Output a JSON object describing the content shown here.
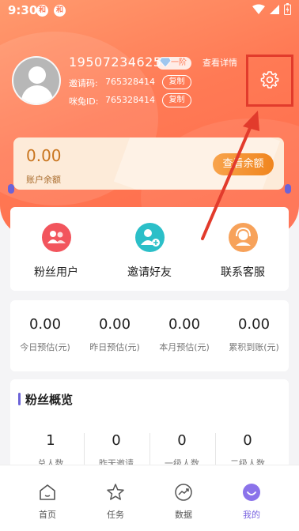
{
  "status_bar": {
    "time": "9:30",
    "badges": [
      "和",
      "和"
    ]
  },
  "profile": {
    "phone": "19507234625",
    "level": "一阶",
    "view_detail": "查看详情",
    "invite_code_label": "邀请码:",
    "invite_code": "765328414",
    "mitu_id_label": "咪兔ID:",
    "mitu_id": "765328414",
    "copy_label": "复制"
  },
  "balance": {
    "amount": "0.00",
    "label": "账户余额",
    "button": "查看余额"
  },
  "actions": [
    {
      "label": "粉丝用户",
      "icon": "fans-icon",
      "color": "#f2555d"
    },
    {
      "label": "邀请好友",
      "icon": "invite-friend-icon",
      "color": "#2bbfc8"
    },
    {
      "label": "联系客服",
      "icon": "customer-service-icon",
      "color": "#f7a25a"
    }
  ],
  "stats": [
    {
      "value": "0.00",
      "label": "今日预估(元)"
    },
    {
      "value": "0.00",
      "label": "昨日预估(元)"
    },
    {
      "value": "0.00",
      "label": "本月预估(元)"
    },
    {
      "value": "0.00",
      "label": "累积到账(元)"
    }
  ],
  "fans_overview": {
    "title": "粉丝概览",
    "items": [
      {
        "value": "1",
        "label": "总人数"
      },
      {
        "value": "0",
        "label": "昨天邀请"
      },
      {
        "value": "0",
        "label": "一级人数"
      },
      {
        "value": "0",
        "label": "二级人数"
      }
    ]
  },
  "tabs": [
    {
      "label": "首页",
      "icon": "home-icon",
      "active": false
    },
    {
      "label": "任务",
      "icon": "star-icon",
      "active": false
    },
    {
      "label": "数据",
      "icon": "chart-icon",
      "active": false
    },
    {
      "label": "我的",
      "icon": "profile-icon",
      "active": true
    }
  ],
  "colors": {
    "header_gradient_start": "#ff9a6e",
    "header_gradient_end": "#ff6a4a",
    "highlight_red": "#e23b2c",
    "accent_purple": "#7a64e0"
  }
}
